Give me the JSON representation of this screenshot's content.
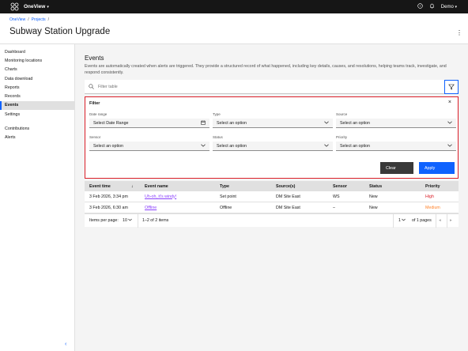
{
  "topbar": {
    "app_name": "OneView",
    "app_chevron": "▾",
    "user": "Demo",
    "user_chevron": "▾",
    "icons": [
      "help-icon",
      "notification-icon"
    ]
  },
  "header": {
    "breadcrumb": [
      "OneView",
      "Projects"
    ],
    "title": "Subway Station Upgrade"
  },
  "sidebar": {
    "items": [
      "Dashboard",
      "Monitoring locations",
      "Charts",
      "Data download",
      "Reports",
      "Records",
      "Events",
      "Settings"
    ],
    "active": "Events",
    "secondary": [
      "Contributions",
      "Alerts"
    ]
  },
  "events": {
    "title": "Events",
    "description": "Events are automatically created when alerts are triggered. They provide a structured record of what happened, including key details, causes, and resolutions, helping teams track, investigate, and respond consistently.",
    "search_placeholder": "Filter table"
  },
  "filter": {
    "title": "Filter",
    "close": "×",
    "fields": [
      {
        "label": "Date range",
        "value": "Select Date Range",
        "icon": "calendar-icon"
      },
      {
        "label": "Type",
        "value": "Select an option",
        "icon": "chevron-down-icon"
      },
      {
        "label": "Source",
        "value": "Select an option",
        "icon": "chevron-down-icon"
      },
      {
        "label": "Sensor",
        "value": "Select an option",
        "icon": "chevron-down-icon"
      },
      {
        "label": "Status",
        "value": "Select an option",
        "icon": "chevron-down-icon"
      },
      {
        "label": "Priority",
        "value": "Select an option",
        "icon": "chevron-down-icon"
      }
    ],
    "clear_label": "Clear",
    "apply_label": "Apply"
  },
  "table": {
    "columns": [
      "Event time",
      "Event name",
      "Type",
      "Source(s)",
      "Sensor",
      "Status",
      "Priority"
    ],
    "sort_indicator": "↓",
    "rows": [
      {
        "time": "3 Feb 2026, 3:34 pm",
        "name": "Uh-oh, it's windy!",
        "type": "Set point",
        "source": "DM Site East",
        "sensor": "WS",
        "status": "New",
        "priority": "High"
      },
      {
        "time": "3 Feb 2026, 6:30 am",
        "name": "Offline",
        "type": "Offline",
        "source": "DM Site East",
        "sensor": "–",
        "status": "New",
        "priority": "Medium"
      }
    ],
    "pagination": {
      "items_per_page_label": "Items per page:",
      "items_per_page": "10",
      "range": "1–2 of 2 items",
      "page": "1",
      "of_pages": "of 1 pages",
      "prev": "◂",
      "next": "▸"
    }
  },
  "colors": {
    "accent": "#0f62fe",
    "highlight_border": "#da1e28",
    "link": "#8a3ffc",
    "priority_high": "#da1e28",
    "priority_medium": "#ff832b"
  }
}
